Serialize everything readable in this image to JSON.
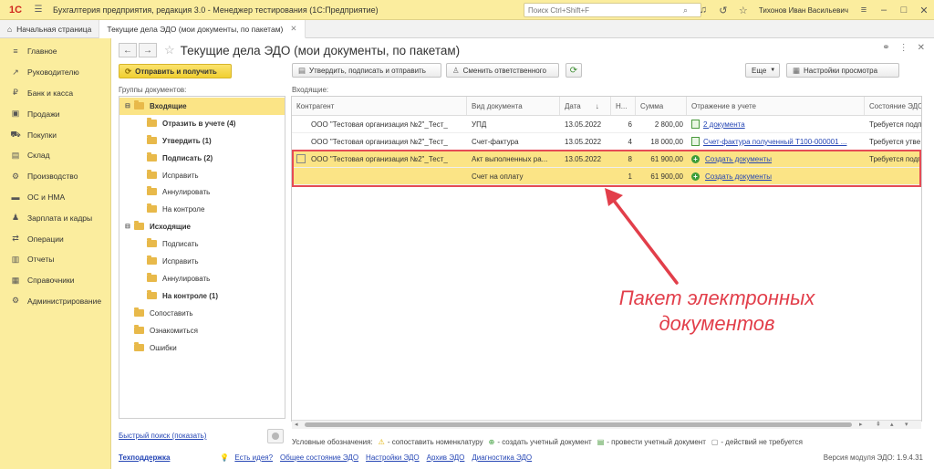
{
  "app": {
    "title": "Бухгалтерия предприятия, редакция 3.0 - Менеджер тестирования (1С:Предприятие)",
    "search_placeholder": "Поиск Ctrl+Shift+F",
    "user": "Тихонов Иван Васильевич"
  },
  "tabs": [
    {
      "label": "Начальная страница"
    },
    {
      "label": "Текущие дела ЭДО (мои документы, по пакетам)"
    }
  ],
  "sidebar": {
    "items": [
      {
        "label": "Главное",
        "icon": "menu-icon"
      },
      {
        "label": "Руководителю",
        "icon": "chart-line-icon"
      },
      {
        "label": "Банк и касса",
        "icon": "coin-icon"
      },
      {
        "label": "Продажи",
        "icon": "bag-icon"
      },
      {
        "label": "Покупки",
        "icon": "cart-icon"
      },
      {
        "label": "Склад",
        "icon": "warehouse-icon"
      },
      {
        "label": "Производство",
        "icon": "factory-icon"
      },
      {
        "label": "ОС и НМА",
        "icon": "truck-icon"
      },
      {
        "label": "Зарплата и кадры",
        "icon": "people-icon"
      },
      {
        "label": "Операции",
        "icon": "operations-icon"
      },
      {
        "label": "Отчеты",
        "icon": "report-icon"
      },
      {
        "label": "Справочники",
        "icon": "book-icon"
      },
      {
        "label": "Администрирование",
        "icon": "gear-icon"
      }
    ]
  },
  "page": {
    "title": "Текущие дела ЭДО (мои документы, по пакетам)"
  },
  "toolbar": {
    "send_receive": "Отправить и получить",
    "approve_sign_send": "Утвердить, подписать и отправить",
    "change_responsible": "Сменить ответственного",
    "more": "Еще",
    "view_settings": "Настройки просмотра"
  },
  "groups": {
    "caption": "Группы документов:",
    "items": [
      {
        "label": "Входящие"
      },
      {
        "label": "Отразить в учете (4)"
      },
      {
        "label": "Утвердить (1)"
      },
      {
        "label": "Подписать (2)"
      },
      {
        "label": "Исправить"
      },
      {
        "label": "Аннулировать"
      },
      {
        "label": "На контроле"
      },
      {
        "label": "Исходящие"
      },
      {
        "label": "Подписать"
      },
      {
        "label": "Исправить"
      },
      {
        "label": "Аннулировать"
      },
      {
        "label": "На контроле (1)"
      },
      {
        "label": "Сопоставить"
      },
      {
        "label": "Ознакомиться"
      },
      {
        "label": "Ошибки"
      }
    ]
  },
  "grid": {
    "caption": "Входящие:",
    "columns": [
      "Контрагент",
      "Вид документа",
      "Дата",
      "Н...",
      "Сумма",
      "Отражение в учете",
      "Состояние ЭДО"
    ],
    "rows": [
      {
        "counterparty": "ООО \"Тестовая организация №2\"_Тест_",
        "doc_type": "УПД",
        "date": "13.05.2022",
        "num": "6",
        "sum": "2 800,00",
        "reflection": "2 документа",
        "state": "Требуется подп"
      },
      {
        "counterparty": "ООО \"Тестовая организация №2\"_Тест_",
        "doc_type": "Счет-фактура",
        "date": "13.05.2022",
        "num": "4",
        "sum": "18 000,00",
        "reflection": "Счет-фактура полученный Т100-000001 ...",
        "state": "Требуется утве"
      },
      {
        "counterparty": "ООО \"Тестовая организация №2\"_Тест_",
        "doc_type": "Акт выполненных ра...",
        "date": "13.05.2022",
        "num": "8",
        "sum": "61 900,00",
        "reflection": "Создать документы",
        "state": "Требуется подп"
      },
      {
        "counterparty": "",
        "doc_type": "Счет на оплату",
        "date": "",
        "num": "1",
        "sum": "61 900,00",
        "reflection": "Создать документы",
        "state": ""
      }
    ]
  },
  "legend": {
    "title": "Условные обозначения:",
    "items": [
      "- сопоставить номенклатуру",
      "- создать учетный документ",
      "- провести учетный документ",
      "- действий не требуется"
    ]
  },
  "footer": {
    "quick_search": "Быстрый поиск (показать)",
    "support": "Техподдержка",
    "idea": "Есть идея?",
    "status": "Общее состояние ЭДО",
    "settings": "Настройки ЭДО",
    "archive": "Архив ЭДО",
    "diagnostics": "Диагностика ЭДО",
    "version": "Версия модуля ЭДО: 1.9.4.31"
  },
  "annotation": {
    "line1": "Пакет электронных",
    "line2": "документов"
  },
  "colors": {
    "accent_yellow": "#fbed9e",
    "selection": "#fbe486",
    "highlight_red": "#e64b55",
    "link": "#2546b5"
  }
}
